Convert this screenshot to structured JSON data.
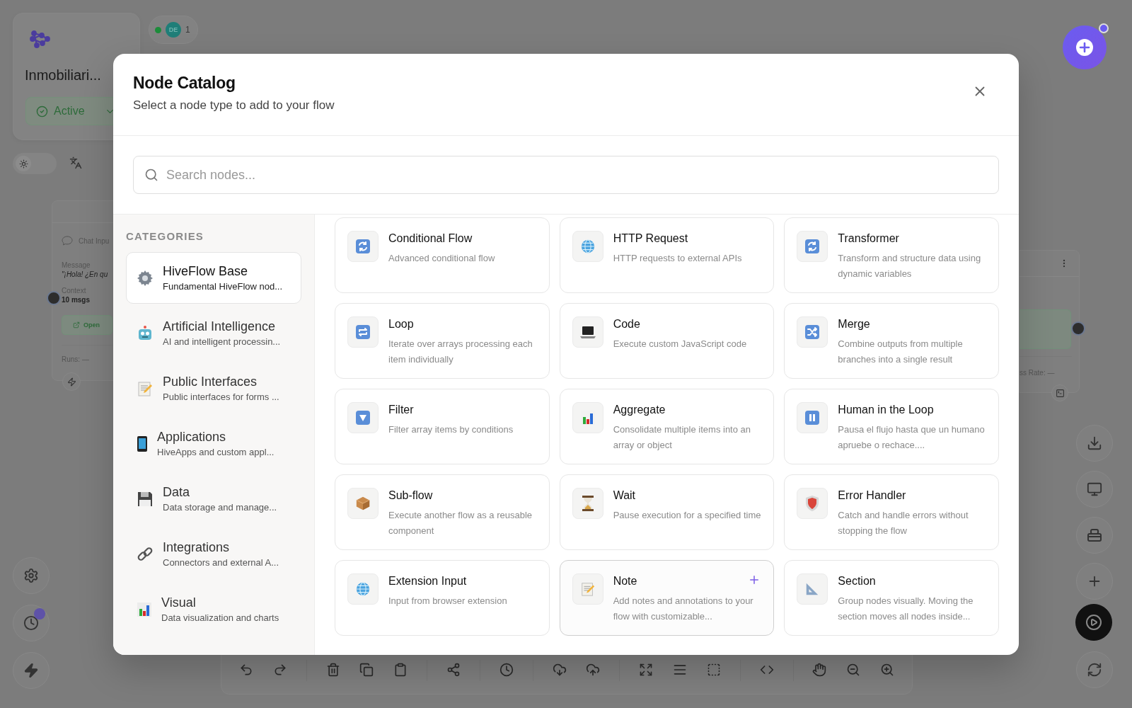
{
  "workflow": {
    "name": "Inmobiliari...",
    "status": "Active"
  },
  "presence": {
    "online": true,
    "initials": "DE",
    "count": "1"
  },
  "history_badge": true,
  "theme_toggle": {
    "on": false
  },
  "canvas_node_left": {
    "title": "Chat Inpu",
    "fields": [
      {
        "label": "Message",
        "value": "\"¡Hola! ¿En qu"
      },
      {
        "label": "Context",
        "value": "10 msgs"
      }
    ],
    "action": "Open",
    "footer": "Runs: —"
  },
  "canvas_node_right": {
    "footer": "ss Rate: —"
  },
  "modal": {
    "title": "Node Catalog",
    "subtitle": "Select a node type to add to your flow",
    "search": {
      "placeholder": "Search nodes..."
    },
    "categories_heading": "CATEGORIES",
    "categories": [
      {
        "name": "HiveFlow Base",
        "description": "Fundamental HiveFlow nod...",
        "selected": true
      },
      {
        "name": "Artificial Intelligence",
        "description": "AI and intelligent processin...",
        "selected": false
      },
      {
        "name": "Public Interfaces",
        "description": "Public interfaces for forms ...",
        "selected": false
      },
      {
        "name": "Applications",
        "description": "HiveApps and custom appl...",
        "selected": false
      },
      {
        "name": "Data",
        "description": "Data storage and manage...",
        "selected": false
      },
      {
        "name": "Integrations",
        "description": "Connectors and external A...",
        "selected": false
      },
      {
        "name": "Visual",
        "description": "Data visualization and charts",
        "selected": false
      }
    ],
    "nodes": [
      {
        "name": "Conditional Flow",
        "description": "Advanced conditional flow",
        "highlighted": false
      },
      {
        "name": "HTTP Request",
        "description": "HTTP requests to external APIs",
        "highlighted": false
      },
      {
        "name": "Transformer",
        "description": "Transform and structure data using dynamic variables",
        "highlighted": false
      },
      {
        "name": "Loop",
        "description": "Iterate over arrays processing each item individually",
        "highlighted": false
      },
      {
        "name": "Code",
        "description": "Execute custom JavaScript code",
        "highlighted": false
      },
      {
        "name": "Merge",
        "description": "Combine outputs from multiple branches into a single result",
        "highlighted": false
      },
      {
        "name": "Filter",
        "description": "Filter array items by conditions",
        "highlighted": false
      },
      {
        "name": "Aggregate",
        "description": "Consolidate multiple items into an array or object",
        "highlighted": false
      },
      {
        "name": "Human in the Loop",
        "description": "Pausa el flujo hasta que un humano apruebe o rechace....",
        "highlighted": false
      },
      {
        "name": "Sub-flow",
        "description": "Execute another flow as a reusable component",
        "highlighted": false
      },
      {
        "name": "Wait",
        "description": "Pause execution for a specified time",
        "highlighted": false
      },
      {
        "name": "Error Handler",
        "description": "Catch and handle errors without stopping the flow",
        "highlighted": false
      },
      {
        "name": "Extension Input",
        "description": "Input from browser extension",
        "highlighted": false
      },
      {
        "name": "Note",
        "description": "Add notes and annotations to your flow with customizable...",
        "highlighted": true
      },
      {
        "name": "Section",
        "description": "Group nodes visually. Moving the section moves all nodes inside...",
        "highlighted": false
      }
    ]
  }
}
